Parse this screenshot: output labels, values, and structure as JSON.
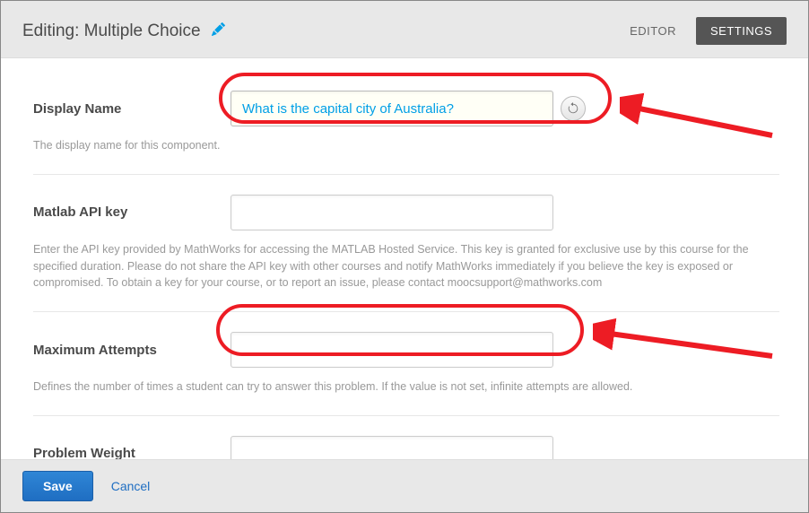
{
  "header": {
    "title": "Editing: Multiple Choice",
    "tabs": {
      "editor": "EDITOR",
      "settings": "SETTINGS"
    }
  },
  "fields": {
    "display_name": {
      "label": "Display Name",
      "value": "What is the capital city of Australia?",
      "help": "The display name for this component."
    },
    "matlab_key": {
      "label": "Matlab API key",
      "value": "",
      "help": "Enter the API key provided by MathWorks for accessing the MATLAB Hosted Service. This key is granted for exclusive use by this course for the specified duration. Please do not share the API key with other courses and notify MathWorks immediately if you believe the key is exposed or compromised. To obtain a key for your course, or to report an issue, please contact moocsupport@mathworks.com"
    },
    "max_attempts": {
      "label": "Maximum Attempts",
      "value": "",
      "help": "Defines the number of times a student can try to answer this problem. If the value is not set, infinite attempts are allowed."
    },
    "problem_weight": {
      "label": "Problem Weight",
      "value": "",
      "help": ""
    }
  },
  "footer": {
    "save": "Save",
    "cancel": "Cancel"
  }
}
